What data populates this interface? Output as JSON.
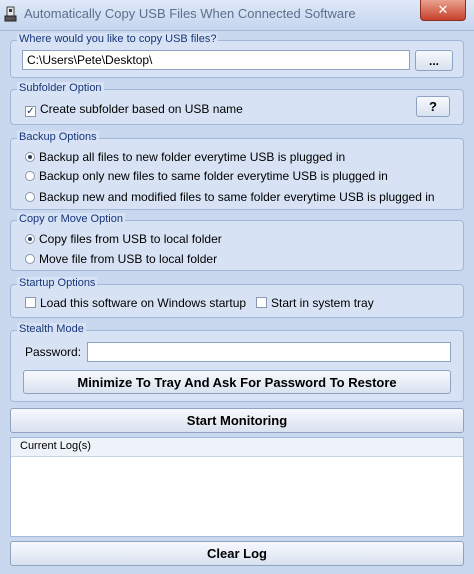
{
  "window": {
    "title": "Automatically Copy USB Files When Connected Software",
    "close_glyph": "✕",
    "app_icon": "usb-app-icon"
  },
  "destination": {
    "legend": "Where would you like to copy USB files?",
    "path_value": "C:\\Users\\Pete\\Desktop\\",
    "browse_label": "..."
  },
  "subfolder": {
    "legend": "Subfolder Option",
    "checkbox_label": "Create subfolder based on USB name",
    "checked": true,
    "help_label": "?"
  },
  "backup": {
    "legend": "Backup Options",
    "options": [
      {
        "label": "Backup all files to new folder everytime USB is plugged in",
        "selected": true
      },
      {
        "label": "Backup only new files to same folder everytime USB is plugged in",
        "selected": false
      },
      {
        "label": "Backup new and modified files to same folder everytime USB is plugged in",
        "selected": false
      }
    ]
  },
  "copy_move": {
    "legend": "Copy or Move Option",
    "options": [
      {
        "label": "Copy files from USB to local folder",
        "selected": true
      },
      {
        "label": "Move file from USB to local folder",
        "selected": false
      }
    ]
  },
  "startup": {
    "legend": "Startup Options",
    "load_label": "Load this software on Windows startup",
    "tray_label": "Start in system tray"
  },
  "stealth": {
    "legend": "Stealth Mode",
    "password_label": "Password:",
    "password_value": "",
    "minimize_label": "Minimize To Tray And Ask For Password To Restore"
  },
  "actions": {
    "start_label": "Start Monitoring",
    "clear_label": "Clear Log"
  },
  "log": {
    "header": "Current Log(s)"
  }
}
